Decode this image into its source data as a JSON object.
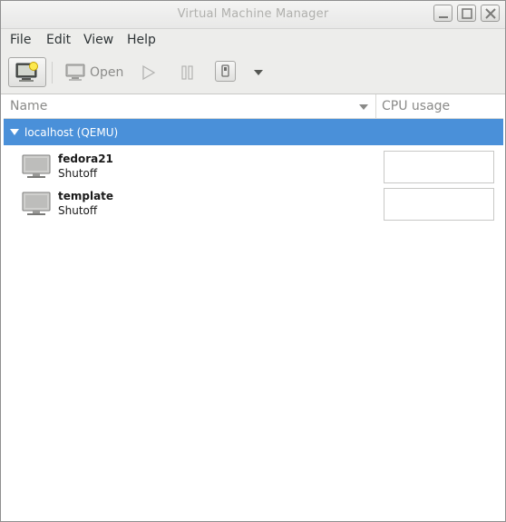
{
  "window": {
    "title": "Virtual Machine Manager"
  },
  "menubar": {
    "items": [
      "File",
      "Edit",
      "View",
      "Help"
    ]
  },
  "toolbar": {
    "new_vm_icon": "computer-new-icon",
    "open_label": "Open",
    "open_icon": "monitor-icon",
    "run_icon": "play-icon",
    "pause_icon": "pause-icon",
    "shutdown_icon": "power-icon",
    "menu_icon": "dropdown-arrow-icon"
  },
  "list": {
    "columns": [
      "Name",
      "CPU usage"
    ],
    "hosts": [
      {
        "label": "localhost (QEMU)",
        "vms": [
          {
            "name": "fedora21",
            "status": "Shutoff"
          },
          {
            "name": "template",
            "status": "Shutoff"
          }
        ]
      }
    ]
  },
  "colors": {
    "selection": "#4a90d9",
    "background": "#ededeb"
  }
}
